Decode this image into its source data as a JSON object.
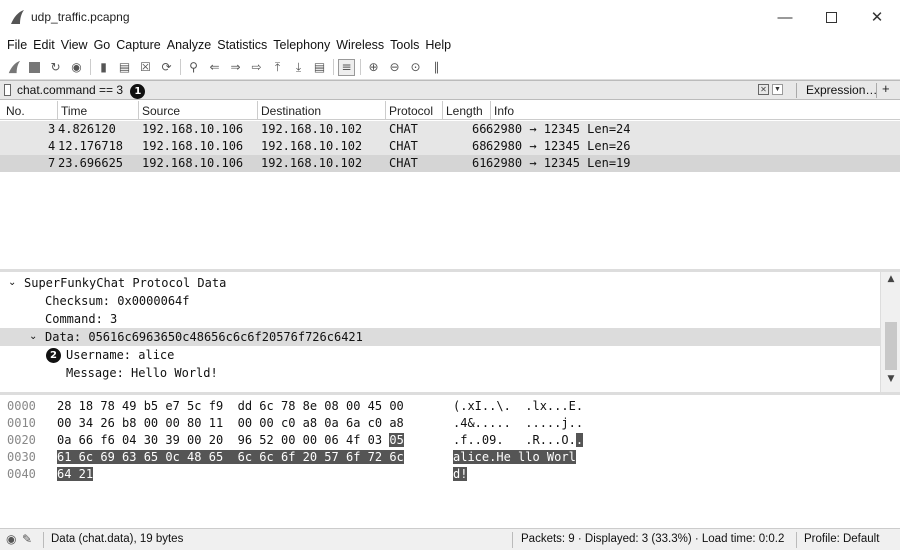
{
  "window": {
    "title": "udp_traffic.pcapng"
  },
  "menu": [
    "File",
    "Edit",
    "View",
    "Go",
    "Capture",
    "Analyze",
    "Statistics",
    "Telephony",
    "Wireless",
    "Tools",
    "Help"
  ],
  "toolbar_icons": [
    "shark-fin-start-icon",
    "stop-square-icon",
    "restart-fin-icon",
    "options-gear-icon",
    "open-file-icon",
    "open-file-icon",
    "close-file-icon",
    "reload-icon",
    "search-icon",
    "go-back-icon",
    "go-forward-icon",
    "go-to-packet-icon",
    "first-packet-icon",
    "last-packet-icon",
    "autoscroll-icon",
    "colorize-icon",
    "zoom-in-icon",
    "zoom-out-icon",
    "zoom-normal-icon",
    "resize-columns-icon"
  ],
  "filter": {
    "value": "chat.command == 3",
    "callout": "1",
    "expression_label": "Expression…",
    "plus": "+"
  },
  "columns": [
    "No.",
    "Time",
    "Source",
    "Destination",
    "Protocol",
    "Length",
    "Info"
  ],
  "packets": [
    {
      "no": "3",
      "time": "4.826120",
      "src": "192.168.10.106",
      "dst": "192.168.10.102",
      "proto": "CHAT",
      "len": "66",
      "info": "62980 → 12345 Len=24"
    },
    {
      "no": "4",
      "time": "12.176718",
      "src": "192.168.10.106",
      "dst": "192.168.10.102",
      "proto": "CHAT",
      "len": "68",
      "info": "62980 → 12345 Len=26"
    },
    {
      "no": "7",
      "time": "23.696625",
      "src": "192.168.10.106",
      "dst": "192.168.10.102",
      "proto": "CHAT",
      "len": "61",
      "info": "62980 → 12345 Len=19"
    }
  ],
  "details": {
    "protocol": "SuperFunkyChat Protocol Data",
    "checksum": "Checksum: 0x0000064f",
    "command": "Command: 3",
    "data": "Data: 05616c6963650c48656c6c6f20576f726c6421",
    "callout": "2",
    "username": "Username: alice",
    "message": "Message: Hello World!"
  },
  "hex": [
    {
      "off": "0000",
      "b1": "28 18 78 49 b5 e7 5c f9  dd 6c 78 8e 08 00 45 00",
      "b2": "",
      "a1": "(.xI..\\.  .lx...E.",
      "a2": ""
    },
    {
      "off": "0010",
      "b1": "00 34 26 b8 00 00 80 11  00 00 c0 a8 0a 6a c0 a8",
      "b2": "",
      "a1": ".4&.....  .....j..",
      "a2": ""
    },
    {
      "off": "0020",
      "b1": "0a 66 f6 04 30 39 00 20  96 52 00 00 06 4f 03 ",
      "b2": "05",
      "a1": ".f..09.   .R...O.",
      "a2": "."
    },
    {
      "off": "0030",
      "b1": "",
      "b2": "61 6c 69 63 65 0c 48 65  6c 6c 6f 20 57 6f 72 6c",
      "a1": "",
      "a2": "alice.He llo Worl"
    },
    {
      "off": "0040",
      "b1": "",
      "b2": "64 21",
      "a1": "",
      "a2": "d!"
    }
  ],
  "status": {
    "field": "Data (chat.data), 19 bytes",
    "packets": "Packets: 9 · Displayed: 3 (33.3%) · Load time: 0:0.2",
    "profile": "Profile: Default"
  }
}
